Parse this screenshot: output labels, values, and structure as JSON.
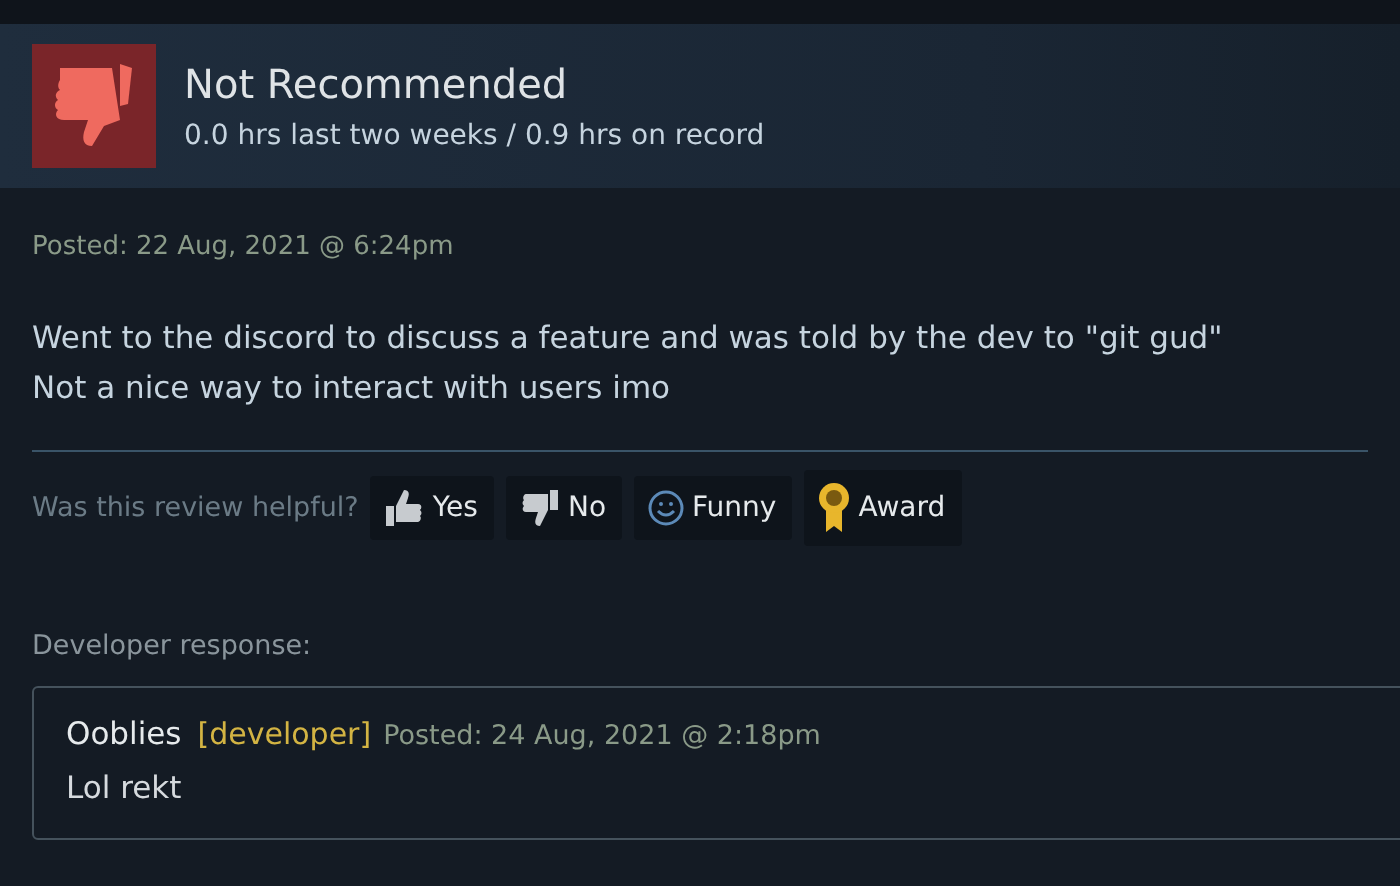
{
  "review": {
    "verdict": "Not Recommended",
    "hours": "0.0 hrs last two weeks / 0.9 hrs on record",
    "posted": "Posted: 22 Aug, 2021 @ 6:24pm",
    "body": [
      "Went to the discord to discuss a feature and was told by the dev to \"git gud\"",
      "Not a nice way to interact with users imo"
    ]
  },
  "helpful": {
    "question": "Was this review helpful?",
    "buttons": [
      {
        "kind": "yes",
        "label": "Yes"
      },
      {
        "kind": "no",
        "label": "No"
      },
      {
        "kind": "funny",
        "label": "Funny"
      },
      {
        "kind": "award",
        "label": "Award"
      }
    ]
  },
  "developer_response": {
    "label": "Developer response:",
    "author": "Ooblies",
    "tag": "[developer]",
    "posted": "Posted: 24 Aug, 2021 @ 2:18pm",
    "text": "Lol rekt"
  }
}
